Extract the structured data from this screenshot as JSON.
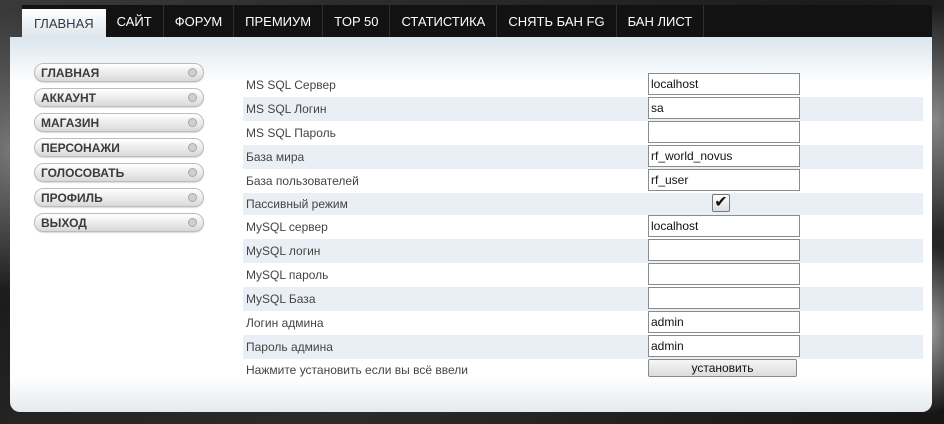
{
  "nav": {
    "tabs": [
      "ГЛАВНАЯ",
      "САЙТ",
      "ФОРУМ",
      "ПРЕМИУМ",
      "TOP 50",
      "СТАТИСТИКА",
      "СНЯТЬ БАН FG",
      "БАН ЛИСТ"
    ]
  },
  "sidebar": {
    "items": [
      "ГЛАВНАЯ",
      "АККАУНТ",
      "МАГАЗИН",
      "ПЕРСОНАЖИ",
      "ГОЛОСОВАТЬ",
      "ПРОФИЛЬ",
      "ВЫХОД"
    ]
  },
  "form": {
    "mssql_server": {
      "label": "MS SQL Сервер",
      "value": "localhost"
    },
    "mssql_login": {
      "label": "MS SQL Логин",
      "value": "sa"
    },
    "mssql_password": {
      "label": "MS SQL Пароль",
      "value": ""
    },
    "world_db": {
      "label": "База мира",
      "value": "rf_world_novus"
    },
    "user_db": {
      "label": "База пользователей",
      "value": "rf_user"
    },
    "passive_mode": {
      "label": "Пассивный режим",
      "checked": true
    },
    "mysql_server": {
      "label": "MySQL сервер",
      "value": "localhost"
    },
    "mysql_login": {
      "label": "MySQL логин",
      "value": ""
    },
    "mysql_password": {
      "label": "MySQL пароль",
      "value": ""
    },
    "mysql_db": {
      "label": "MySQL База",
      "value": ""
    },
    "admin_login": {
      "label": "Логин админа",
      "value": "admin"
    },
    "admin_password": {
      "label": "Пароль админа",
      "value": "admin"
    },
    "footer_note": "Нажмите установить если вы всё ввели",
    "install_label": "установить"
  }
}
